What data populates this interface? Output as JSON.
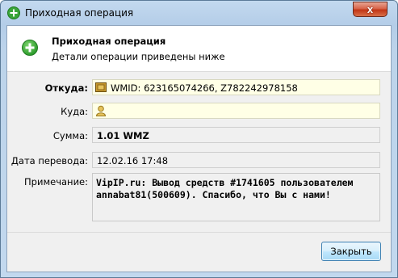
{
  "window": {
    "title": "Приходная операция",
    "close_glyph": "x",
    "app_icon": "green-plus-icon"
  },
  "header": {
    "icon": "green-plus-icon",
    "title": "Приходная операция",
    "subtitle": "Детали операции приведены ниже"
  },
  "form": {
    "from": {
      "label": "Откуда:",
      "value": "WMID: 623165074266, Z782242978158",
      "icon": "wallet-icon"
    },
    "to": {
      "label": "Куда:",
      "value": "",
      "icon": "user-icon"
    },
    "amount": {
      "label": "Сумма:",
      "value": "1.01 WMZ"
    },
    "date": {
      "label": "Дата перевода:",
      "value": "12.02.16 17:48"
    },
    "note": {
      "label": "Примечание:",
      "value": "VipIP.ru: Вывод средств #1741605 пользователем\nannabat81(500609). Спасибо, что Вы с нами!"
    }
  },
  "buttons": {
    "close_label": "Закрыть"
  },
  "colors": {
    "title_bar": "#b9d1ea",
    "close_button": "#c23616",
    "highlight_field": "#ffffe6",
    "accent_button": "#bee6fd"
  }
}
